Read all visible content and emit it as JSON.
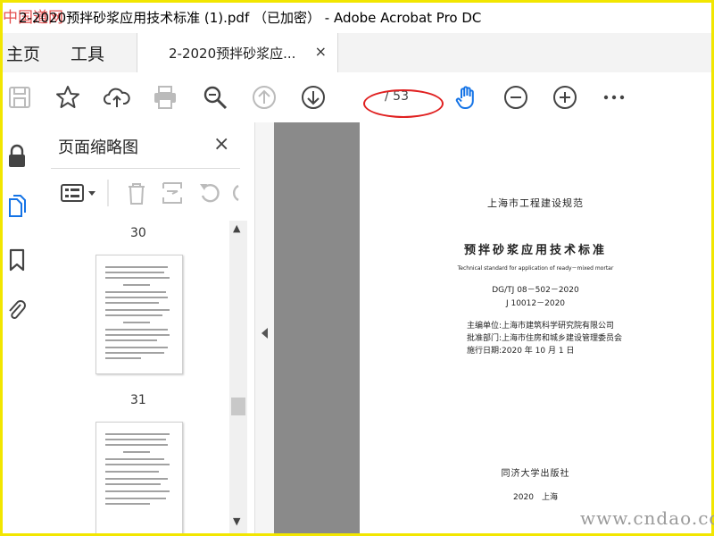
{
  "window": {
    "title": "2-2020预拌砂浆应用技术标准 (1).pdf （已加密） - Adobe Acrobat Pro DC",
    "watermark_logo": "中国道网"
  },
  "tabs": {
    "home": "主页",
    "tools": "工具",
    "doc": "2-2020预拌砂浆应...",
    "close": "×"
  },
  "toolbar": {
    "page_count": "/ 53"
  },
  "panel": {
    "title": "页面缩略图",
    "close": "×",
    "pages": [
      {
        "label": "30"
      },
      {
        "label": "31"
      }
    ]
  },
  "document": {
    "header": "上海市工程建设规范",
    "title_cn": "预拌砂浆应用技术标准",
    "title_en": "Technical standard for application of ready－mixed mortar",
    "code1": "DG/TJ 08－502－2020",
    "code2": "J 10012－2020",
    "editor": "主编单位:上海市建筑科学研究院有限公司",
    "approver": "批准部门:上海市住房和城乡建设管理委员会",
    "effective": "施行日期:2020 年 10 月 1 日",
    "publisher": "同济大学出版社",
    "year_place": "2020　上海"
  },
  "site_watermark": "www.cndao.com"
}
